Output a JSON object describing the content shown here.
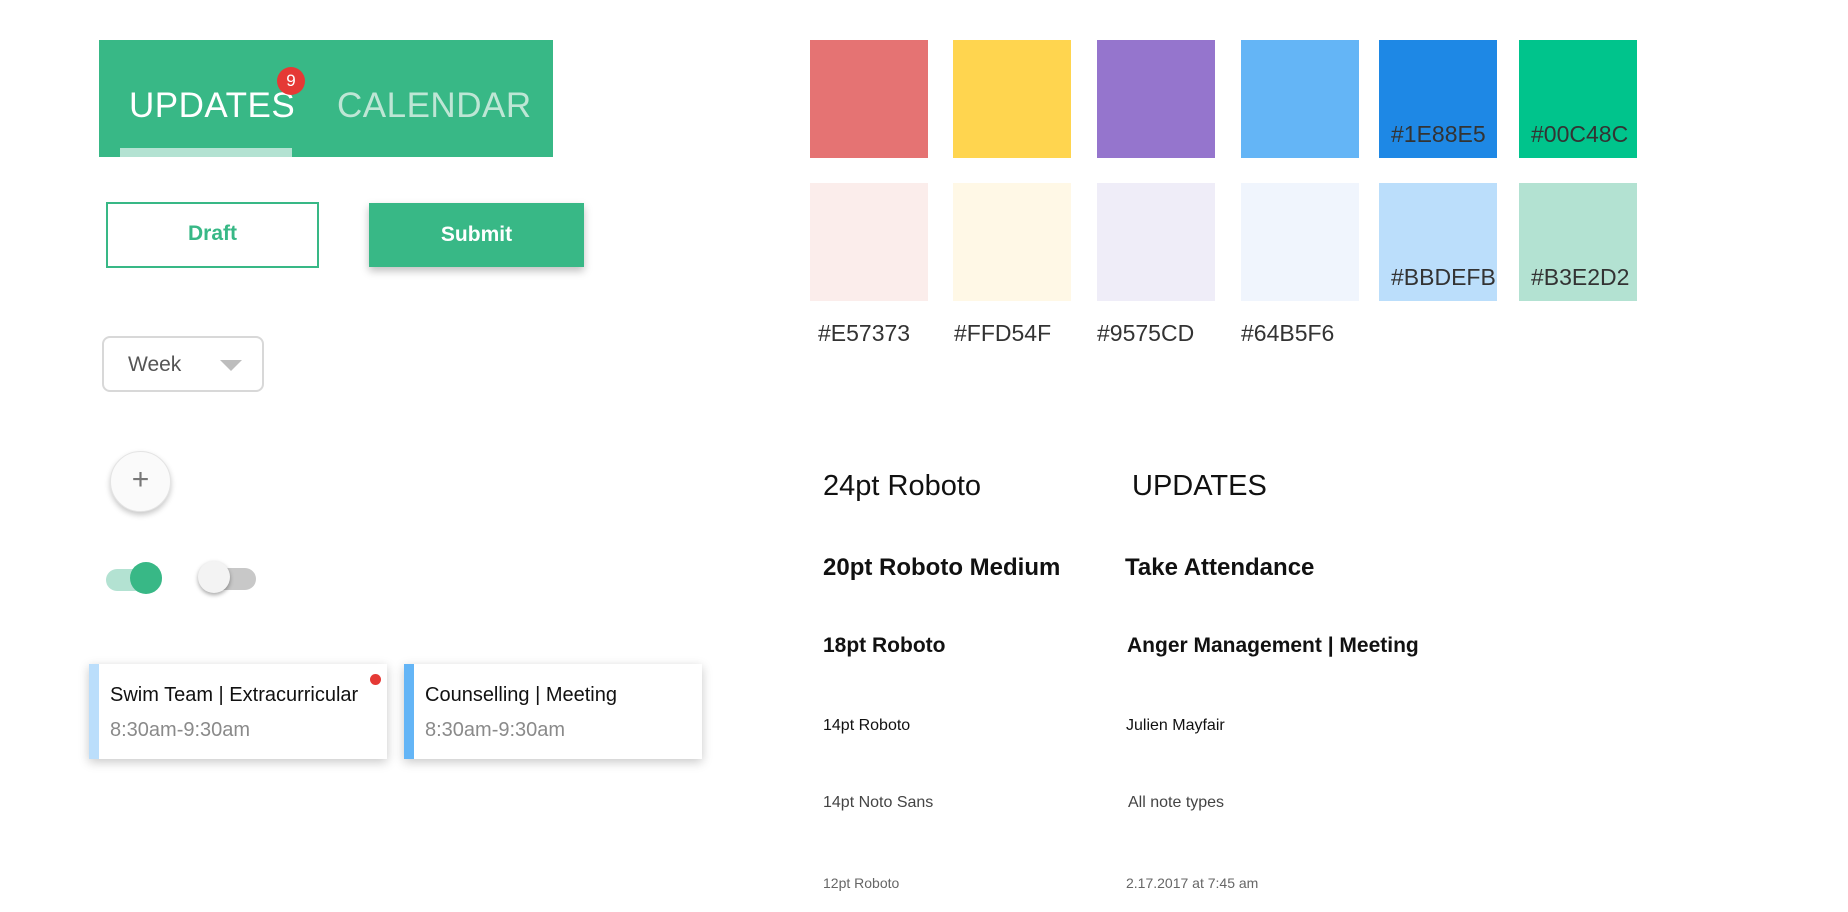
{
  "tabs": {
    "updates_label": "UPDATES",
    "calendar_label": "CALENDAR",
    "badge_count": "9"
  },
  "buttons": {
    "draft_label": "Draft",
    "submit_label": "Submit"
  },
  "dropdown": {
    "selected": "Week"
  },
  "fab": {
    "symbol": "+"
  },
  "toggles": {
    "first_on": true,
    "second_on": false
  },
  "cards": [
    {
      "title": "Swim Team | Extracurricular",
      "time": "8:30am-9:30am",
      "unread": true
    },
    {
      "title": "Counselling | Meeting",
      "time": "8:30am-9:30am",
      "unread": false
    }
  ],
  "swatches": {
    "row1": [
      "#E57373",
      "#FFD54F",
      "#9575CD",
      "#64B5F6",
      "#1E88E5",
      "#00C48C"
    ],
    "row2": [
      "#FBEDEB",
      "#FFF8E6",
      "#EFEDF8",
      "#F0F5FD",
      "#BBDEFB",
      "#B3E2D2"
    ],
    "labels": [
      "#E57373",
      "#FFD54F",
      "#9575CD",
      "#64B5F6"
    ],
    "inner_labels": {
      "primary_dark": "#1E88E5",
      "primary_green": "#00C48C",
      "light_blue": "#BBDEFB",
      "light_green": "#B3E2D2"
    }
  },
  "typography": [
    {
      "spec": "24pt Roboto",
      "sample": "UPDATES"
    },
    {
      "spec": "20pt   Roboto Medium",
      "sample": "Take Attendance"
    },
    {
      "spec": "18pt   Roboto",
      "sample": "Anger Management | Meeting"
    },
    {
      "spec": "14pt      Roboto",
      "sample": "Julien Mayfair"
    },
    {
      "spec": "14pt     Noto Sans",
      "sample": "All note types"
    },
    {
      "spec": "12pt        Roboto",
      "sample": "2.17.2017 at 7:45 am"
    }
  ]
}
